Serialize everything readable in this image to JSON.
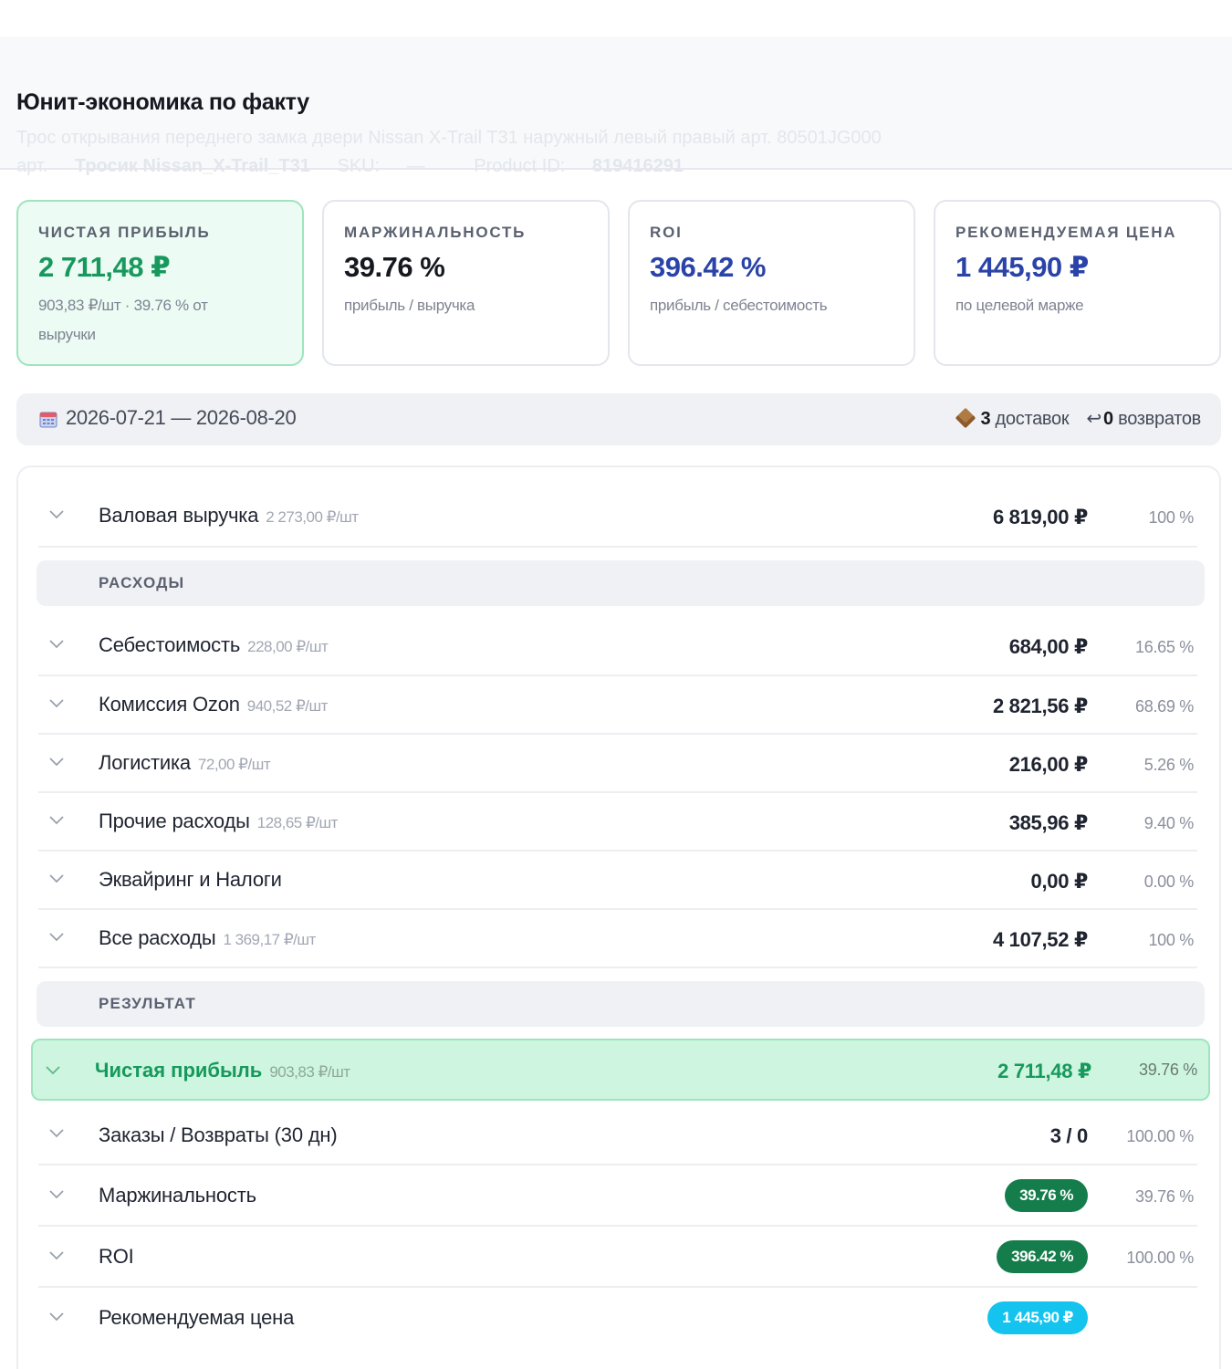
{
  "header": {
    "title": "Юнит-экономика по факту",
    "product_name": "Трос открывания переднего замка двери Nissan X-Trail T31 наружный левый правый арт. 80501JG000",
    "article_prefix": "арт.",
    "article": "Тросик Nissan_X-Trail_T31",
    "sku_label": "SKU:",
    "sku_value": "—",
    "product_id_label": "Product ID:",
    "product_id_value": "819416291"
  },
  "kpis": [
    {
      "label": "ЧИСТАЯ ПРИБЫЛЬ",
      "value": "2 711,48 ₽",
      "hint": "903,83 ₽/шт · 39.76 % от выручки",
      "color": "#17995d"
    },
    {
      "label": "МАРЖИНАЛЬНОСТЬ",
      "value": "39.76 %",
      "hint": "прибыль / выручка",
      "color": "#15181f"
    },
    {
      "label": "ROI",
      "value": "396.42 %",
      "hint": "прибыль / себестоимость",
      "color": "#2a43a8"
    },
    {
      "label": "РЕКОМЕНДУЕМАЯ ЦЕНА",
      "value": "1 445,90 ₽",
      "hint": "по целевой марже",
      "color": "#2a43a8"
    }
  ],
  "period": {
    "range": "2026-07-21 — 2026-08-20",
    "deliveries_count": "3",
    "deliveries_label": "доставок",
    "returns_icon": "↩",
    "returns_count": "0",
    "returns_label": "возвратов"
  },
  "table": {
    "revenue": {
      "name": "Валовая выручка",
      "unit": "2 273,00 ₽/шт",
      "value": "6 819,00 ₽",
      "pct": "100 %"
    },
    "expenses_section": "РАСХОДЫ",
    "expenses": [
      {
        "name": "Себестоимость",
        "unit": "228,00 ₽/шт",
        "value": "684,00 ₽",
        "pct": "16.65 %"
      },
      {
        "name": "Комиссия Ozon",
        "unit": "940,52 ₽/шт",
        "value": "2 821,56 ₽",
        "pct": "68.69 %"
      },
      {
        "name": "Логистика",
        "unit": "72,00 ₽/шт",
        "value": "216,00 ₽",
        "pct": "5.26 %"
      },
      {
        "name": "Прочие расходы",
        "unit": "128,65 ₽/шт",
        "value": "385,96 ₽",
        "pct": "9.40 %"
      },
      {
        "name": "Эквайринг и Налоги",
        "unit": "",
        "value": "0,00 ₽",
        "pct": "0.00 %"
      },
      {
        "name": "Все расходы",
        "unit": "1 369,17 ₽/шт",
        "value": "4 107,52 ₽",
        "pct": "100 %"
      }
    ],
    "result_section": "РЕЗУЛЬТАТ",
    "net_profit": {
      "name": "Чистая прибыль",
      "unit": "903,83 ₽/шт",
      "value": "2 711,48 ₽",
      "pct": "39.76 %"
    },
    "orders": {
      "name": "Заказы / Возвраты (30 дн)",
      "value": "3 / 0",
      "pct": "100.00 %"
    },
    "margin": {
      "name": "Маржинальность",
      "badge": "39.76 %",
      "pct": "39.76 %"
    },
    "roi": {
      "name": "ROI",
      "badge": "396.42 %",
      "pct": "100.00 %"
    },
    "rec_price": {
      "name": "Рекомендуемая цена",
      "badge": "1 445,90 ₽"
    }
  },
  "colors": {
    "accent_green": "#17995d",
    "accent_blue": "#2a43a8",
    "badge_dark_green": "#157d4b",
    "badge_cyan": "#14c3ee"
  },
  "icons": {
    "calendar": "calendar-icon",
    "box": "box-icon",
    "return": "return-arrow-icon",
    "chevron": "chevron-down-icon"
  }
}
